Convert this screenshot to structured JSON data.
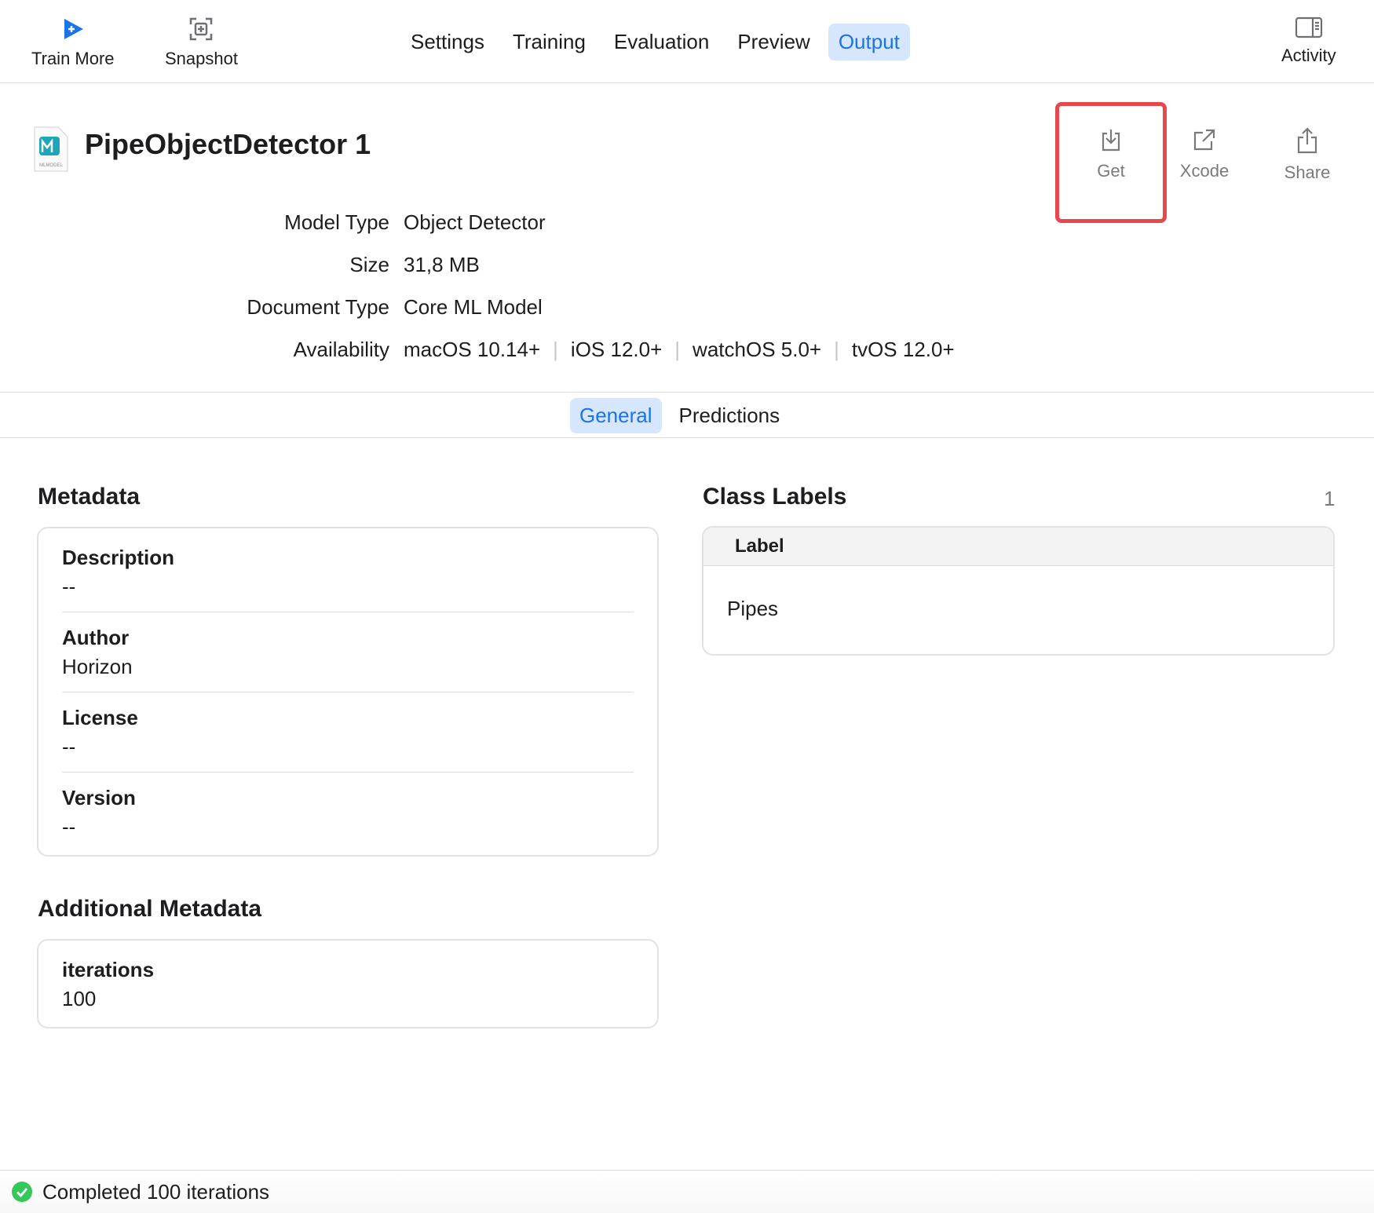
{
  "toolbar": {
    "train_more": "Train More",
    "snapshot": "Snapshot",
    "activity": "Activity",
    "tabs": [
      "Settings",
      "Training",
      "Evaluation",
      "Preview",
      "Output"
    ],
    "active_tab": "Output"
  },
  "model": {
    "name": "PipeObjectDetector 1",
    "icon_caption": "MLMODEL",
    "info": [
      {
        "key": "Model Type",
        "value": "Object Detector"
      },
      {
        "key": "Size",
        "value": "31,8 MB"
      },
      {
        "key": "Document Type",
        "value": "Core ML Model"
      }
    ],
    "availability_label": "Availability",
    "availability": [
      "macOS 10.14+",
      "iOS 12.0+",
      "watchOS 5.0+",
      "tvOS 12.0+"
    ]
  },
  "actions": {
    "get": "Get",
    "xcode": "Xcode",
    "share": "Share"
  },
  "subtabs": {
    "general": "General",
    "predictions": "Predictions",
    "active": "General"
  },
  "metadata": {
    "title": "Metadata",
    "fields": [
      {
        "key": "Description",
        "value": "--"
      },
      {
        "key": "Author",
        "value": "Horizon"
      },
      {
        "key": "License",
        "value": "--"
      },
      {
        "key": "Version",
        "value": "--"
      }
    ]
  },
  "additional_metadata": {
    "title": "Additional Metadata",
    "fields": [
      {
        "key": "iterations",
        "value": "100"
      }
    ]
  },
  "class_labels": {
    "title": "Class Labels",
    "count": "1",
    "column": "Label",
    "rows": [
      "Pipes"
    ]
  },
  "status": {
    "text": "Completed 100 iterations"
  },
  "colors": {
    "accent": "#1a73e8",
    "highlight": "#e5484d",
    "success": "#34c759"
  }
}
